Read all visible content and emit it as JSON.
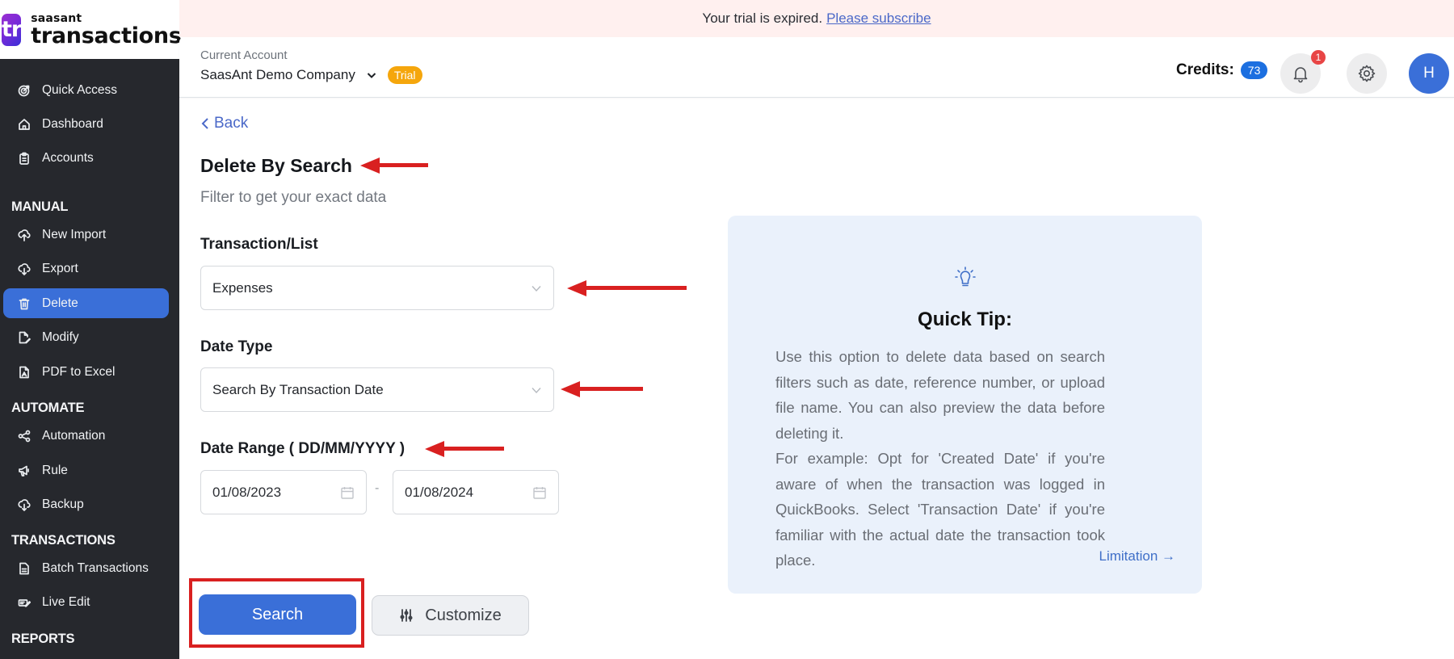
{
  "brand": {
    "logo_mark": "tr",
    "name_small": "saasant",
    "name_big": "transactions"
  },
  "banner": {
    "message": "Your trial is expired.",
    "link": "Please subscribe"
  },
  "header": {
    "account_caption": "Current Account",
    "account_name": "SaasAnt Demo Company",
    "plan_badge": "Trial",
    "credits_label": "Credits:",
    "credits_value": "73",
    "notification_count": "1",
    "avatar_initial": "H"
  },
  "sidebar": {
    "items": [
      {
        "label": "Quick Access",
        "icon": "target-icon"
      },
      {
        "label": "Dashboard",
        "icon": "home-icon"
      },
      {
        "label": "Accounts",
        "icon": "clipboard-icon"
      },
      {
        "label": "New Import",
        "icon": "cloud-upload-icon"
      },
      {
        "label": "Export",
        "icon": "cloud-download-icon"
      },
      {
        "label": "Delete",
        "icon": "trash-icon",
        "active": true
      },
      {
        "label": "Modify",
        "icon": "file-edit-icon"
      },
      {
        "label": "PDF to Excel",
        "icon": "pdf-file-icon"
      },
      {
        "label": "Automation",
        "icon": "share-nodes-icon"
      },
      {
        "label": "Rule",
        "icon": "megaphone-icon"
      },
      {
        "label": "Backup",
        "icon": "cloud-download-icon"
      },
      {
        "label": "Batch Transactions",
        "icon": "document-icon"
      },
      {
        "label": "Live Edit",
        "icon": "edit-lines-icon"
      }
    ],
    "sections": [
      "MANUAL",
      "AUTOMATE",
      "TRANSACTIONS",
      "REPORTS"
    ]
  },
  "main": {
    "back_label": "Back",
    "title": "Delete By Search",
    "subtitle": "Filter to get your exact data",
    "transaction_label": "Transaction/List",
    "transaction_value": "Expenses",
    "date_type_label": "Date Type",
    "date_type_value": "Search By Transaction Date",
    "date_range_label": "Date Range ( DD/MM/YYYY )",
    "date_from": "01/08/2023",
    "date_separator": "-",
    "date_to": "01/08/2024",
    "search_button": "Search",
    "customize_button": "Customize"
  },
  "tip": {
    "title": "Quick Tip:",
    "paragraph1": "Use this option to delete data based on search filters such as date, reference number, or upload file name. You can also preview the data before deleting it.",
    "paragraph2": "For example: Opt for 'Created Date' if you're aware of when the transaction was logged in QuickBooks. Select 'Transaction Date' if you're familiar with the actual date the transaction took place.",
    "link": "Limitation →"
  },
  "annotations": {
    "arrow_color": "#d92020",
    "highlight_color": "#d92020"
  }
}
